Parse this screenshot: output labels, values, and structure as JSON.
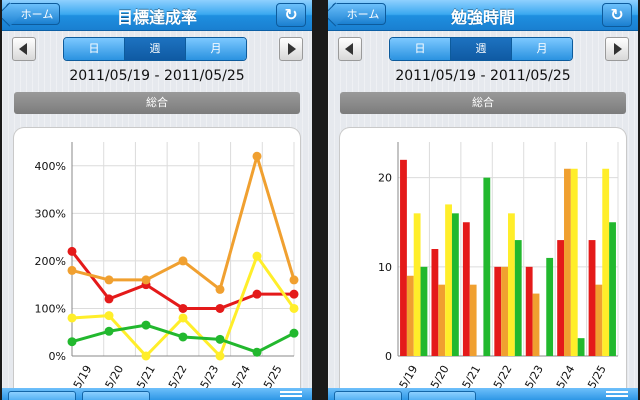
{
  "screens": [
    {
      "title": "目標達成率",
      "back_label": "ホーム",
      "refresh_icon": "refresh-icon",
      "segments": [
        "日",
        "週",
        "月"
      ],
      "selected_segment": 1,
      "date_range": "2011/05/19 - 2011/05/25",
      "section_label": "総合"
    },
    {
      "title": "勉強時間",
      "back_label": "ホーム",
      "refresh_icon": "refresh-icon",
      "segments": [
        "日",
        "週",
        "月"
      ],
      "selected_segment": 1,
      "date_range": "2011/05/19 - 2011/05/25",
      "section_label": "総合"
    }
  ],
  "colors": {
    "red": "#e41a1a",
    "orange": "#f0a030",
    "yellow": "#ffee2a",
    "green": "#22b82e",
    "navbar": "#1e8fe0"
  },
  "chart_data": [
    {
      "type": "line",
      "categories": [
        "5/19",
        "5/20",
        "5/21",
        "5/22",
        "5/23",
        "5/24",
        "5/25"
      ],
      "ylim": [
        0,
        450
      ],
      "yticks": [
        "0%",
        "100%",
        "200%",
        "300%",
        "400%"
      ],
      "ytick_values": [
        0,
        100,
        200,
        300,
        400
      ],
      "grid": true,
      "series": [
        {
          "color": "#e41a1a",
          "values": [
            220,
            120,
            150,
            100,
            100,
            130,
            130
          ]
        },
        {
          "color": "#f0a030",
          "values": [
            180,
            160,
            160,
            200,
            140,
            420,
            160
          ]
        },
        {
          "color": "#ffee2a",
          "values": [
            80,
            85,
            0,
            80,
            0,
            210,
            100
          ]
        },
        {
          "color": "#22b82e",
          "values": [
            30,
            52,
            65,
            40,
            35,
            8,
            48
          ]
        }
      ]
    },
    {
      "type": "bar",
      "categories": [
        "5/19",
        "5/20",
        "5/21",
        "5/22",
        "5/23",
        "5/24",
        "5/25"
      ],
      "ylim": [
        0,
        24
      ],
      "yticks": [
        "0",
        "10",
        "20"
      ],
      "ytick_values": [
        0,
        10,
        20
      ],
      "grid": true,
      "series": [
        {
          "color": "#e41a1a",
          "values": [
            22,
            12,
            15,
            10,
            10,
            13,
            13
          ]
        },
        {
          "color": "#f0a030",
          "values": [
            9,
            8,
            8,
            10,
            7,
            21,
            8
          ]
        },
        {
          "color": "#ffee2a",
          "values": [
            16,
            17,
            0,
            16,
            0,
            21,
            21
          ]
        },
        {
          "color": "#22b82e",
          "values": [
            10,
            16,
            20,
            13,
            11,
            2,
            15
          ]
        }
      ]
    }
  ]
}
